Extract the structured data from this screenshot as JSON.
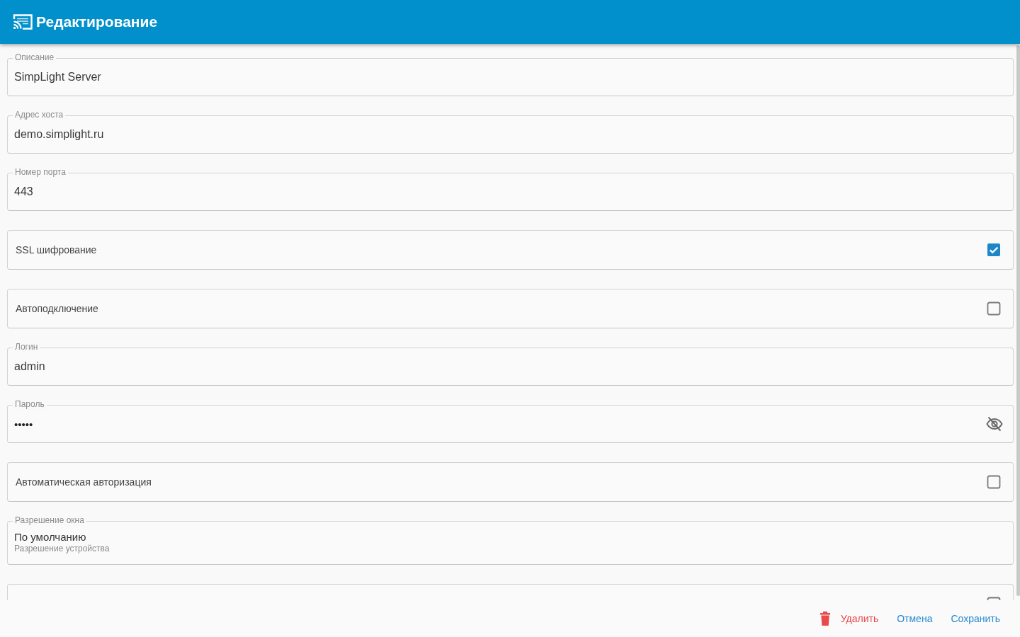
{
  "app_bar": {
    "title": "Редактирование"
  },
  "form": {
    "items": [
      {
        "kind": "text",
        "label": "Описание",
        "value": "SimpLight Server"
      },
      {
        "kind": "text",
        "label": "Адрес хоста",
        "value": "demo.simplight.ru"
      },
      {
        "kind": "text",
        "label": "Номер порта",
        "value": "443"
      },
      {
        "kind": "checkbox",
        "label": "SSL шифрование",
        "checked": true
      },
      {
        "kind": "checkbox",
        "label": "Автоподключение",
        "checked": false
      },
      {
        "kind": "text",
        "label": "Логин",
        "value": "admin"
      },
      {
        "kind": "password",
        "label": "Пароль",
        "value": "•••••"
      },
      {
        "kind": "checkbox",
        "label": "Автоматическая авторизация",
        "checked": false
      },
      {
        "kind": "select",
        "label": "Разрешение окна",
        "value": "По умолчанию",
        "helper": "Разрешение устройства"
      },
      {
        "kind": "checkbox",
        "checked": false
      }
    ]
  },
  "footer": {
    "buttons": [
      {
        "kind": "danger",
        "label": "Удалить"
      },
      {
        "kind": "plain",
        "label": "Отмена"
      },
      {
        "kind": "plain",
        "label": "Сохранить"
      }
    ]
  }
}
